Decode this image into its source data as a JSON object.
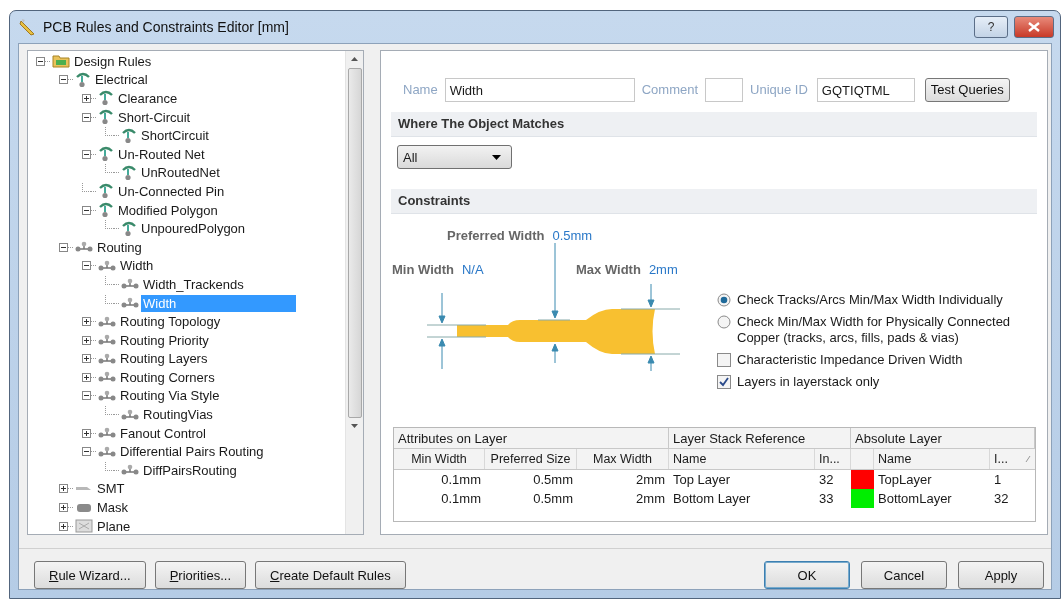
{
  "window": {
    "title": "PCB Rules and Constraints Editor [mm]",
    "help": "?"
  },
  "tree": [
    {
      "label": "Design Rules",
      "kind": "folder",
      "expanded": true,
      "selected": false,
      "children": [
        {
          "label": "Electrical",
          "kind": "electrical",
          "expanded": true,
          "selected": false,
          "children": [
            {
              "label": "Clearance",
              "kind": "electrical",
              "expanded": false,
              "selected": false
            },
            {
              "label": "Short-Circuit",
              "kind": "electrical",
              "expanded": true,
              "selected": false,
              "children": [
                {
                  "label": "ShortCircuit",
                  "kind": "electrical",
                  "selected": false
                }
              ]
            },
            {
              "label": "Un-Routed Net",
              "kind": "electrical",
              "expanded": true,
              "selected": false,
              "children": [
                {
                  "label": "UnRoutedNet",
                  "kind": "electrical",
                  "selected": false
                }
              ]
            },
            {
              "label": "Un-Connected Pin",
              "kind": "electrical",
              "selected": false
            },
            {
              "label": "Modified Polygon",
              "kind": "electrical",
              "expanded": true,
              "selected": false,
              "children": [
                {
                  "label": "UnpouredPolygon",
                  "kind": "electrical",
                  "selected": false
                }
              ]
            }
          ]
        },
        {
          "label": "Routing",
          "kind": "routing",
          "expanded": true,
          "selected": false,
          "children": [
            {
              "label": "Width",
              "kind": "routing",
              "expanded": true,
              "selected": false,
              "children": [
                {
                  "label": "Width_Trackends",
                  "kind": "routing",
                  "selected": false
                },
                {
                  "label": "Width",
                  "kind": "routing",
                  "selected": true
                }
              ]
            },
            {
              "label": "Routing Topology",
              "kind": "routing",
              "expanded": false,
              "selected": false
            },
            {
              "label": "Routing Priority",
              "kind": "routing",
              "expanded": false,
              "selected": false
            },
            {
              "label": "Routing Layers",
              "kind": "routing",
              "expanded": false,
              "selected": false
            },
            {
              "label": "Routing Corners",
              "kind": "routing",
              "expanded": false,
              "selected": false
            },
            {
              "label": "Routing Via Style",
              "kind": "routing",
              "expanded": true,
              "selected": false,
              "children": [
                {
                  "label": "RoutingVias",
                  "kind": "routing",
                  "selected": false
                }
              ]
            },
            {
              "label": "Fanout Control",
              "kind": "routing",
              "expanded": false,
              "selected": false
            },
            {
              "label": "Differential Pairs Routing",
              "kind": "routing",
              "expanded": true,
              "selected": false,
              "children": [
                {
                  "label": "DiffPairsRouting",
                  "kind": "routing",
                  "selected": false
                }
              ]
            }
          ]
        },
        {
          "label": "SMT",
          "kind": "smt",
          "expanded": false,
          "selected": false
        },
        {
          "label": "Mask",
          "kind": "mask",
          "expanded": false,
          "selected": false
        },
        {
          "label": "Plane",
          "kind": "plane",
          "expanded": false,
          "selected": false
        }
      ]
    }
  ],
  "rule": {
    "name_label": "Name",
    "name": "Width",
    "comment_label": "Comment",
    "unique_id_label": "Unique ID",
    "unique_id": "GQTIQTML",
    "test_button": "Test Queries"
  },
  "match_section": {
    "title": "Where The Object Matches",
    "query": "All"
  },
  "constraints": {
    "title": "Constraints",
    "preferred_label": "Preferred Width",
    "preferred": "0.5mm",
    "min_label": "Min Width",
    "min": "N/A",
    "max_label": "Max Width",
    "max": "2mm",
    "options": [
      {
        "kind": "radio",
        "label": "Check Tracks/Arcs Min/Max Width Individually",
        "selected": true
      },
      {
        "kind": "radio",
        "label": "Check Min/Max Width for Physically Connected Copper (tracks, arcs, fills, pads & vias)",
        "selected": false
      },
      {
        "kind": "checkbox",
        "label": "Characteristic Impedance Driven Width",
        "checked": false
      },
      {
        "kind": "checkbox",
        "label": "Layers in layerstack only",
        "checked": true
      }
    ]
  },
  "layer_table": {
    "groups": [
      "Attributes on Layer",
      "Layer Stack Reference",
      "Absolute Layer"
    ],
    "columns": [
      "Min Width",
      "Preferred Size",
      "Max Width",
      "Name",
      "In...",
      "Name",
      "I..."
    ],
    "rows": [
      {
        "min": "0.1mm",
        "preferred": "0.5mm",
        "max": "2mm",
        "stack_name": "Top Layer",
        "stack_index": "32",
        "color": "#ff0000",
        "layer_name": "TopLayer",
        "layer_index": "1"
      },
      {
        "min": "0.1mm",
        "preferred": "0.5mm",
        "max": "2mm",
        "stack_name": "Bottom Layer",
        "stack_index": "33",
        "color": "#00ee00",
        "layer_name": "BottomLayer",
        "layer_index": "32"
      }
    ]
  },
  "buttons_left": [
    {
      "label": "Rule Wizard..."
    },
    {
      "label": "Priorities..."
    },
    {
      "label": "Create Default Rules"
    }
  ],
  "buttons_right": [
    {
      "label": "OK",
      "default": true
    },
    {
      "label": "Cancel",
      "default": false
    },
    {
      "label": "Apply",
      "default": false
    }
  ]
}
